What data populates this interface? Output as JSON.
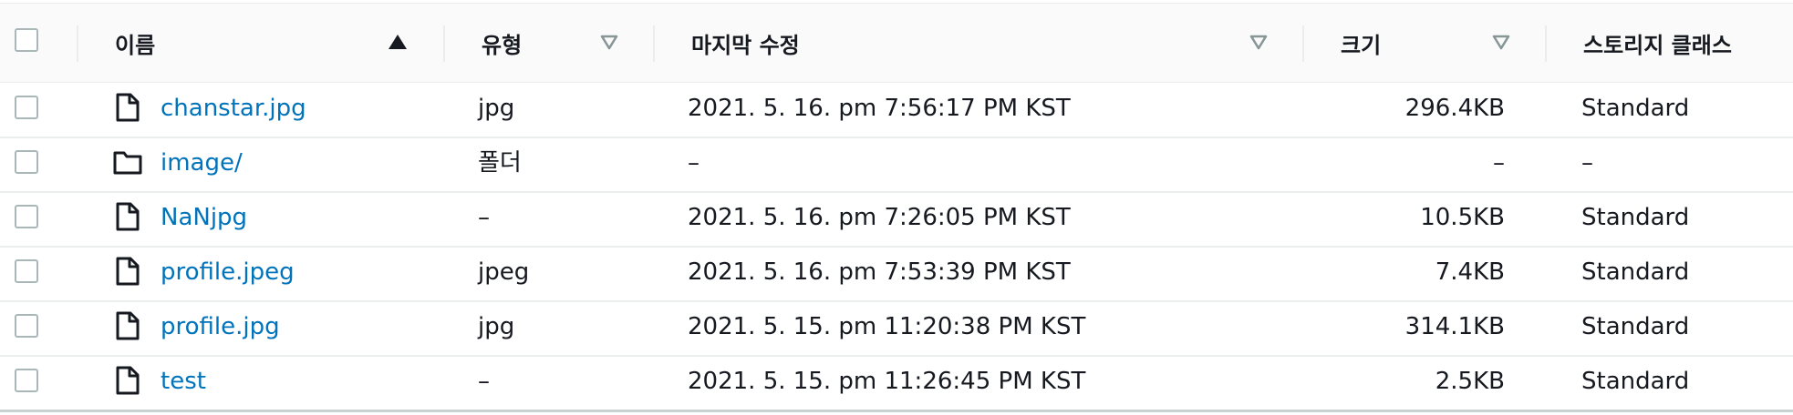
{
  "header": {
    "name_label": "이름",
    "type_label": "유형",
    "modified_label": "마지막 수정",
    "size_label": "크기",
    "storage_class_label": "스토리지 클래스"
  },
  "rows": [
    {
      "name": "chanstar.jpg",
      "kind": "file",
      "type": "jpg",
      "modified": "2021. 5. 16. pm 7:56:17 PM KST",
      "size": "296.4KB",
      "storage": "Standard"
    },
    {
      "name": "image/",
      "kind": "folder",
      "type": "폴더",
      "modified": "–",
      "size": "–",
      "storage": "–"
    },
    {
      "name": "NaNjpg",
      "kind": "file",
      "type": "–",
      "modified": "2021. 5. 16. pm 7:26:05 PM KST",
      "size": "10.5KB",
      "storage": "Standard"
    },
    {
      "name": "profile.jpeg",
      "kind": "file",
      "type": "jpeg",
      "modified": "2021. 5. 16. pm 7:53:39 PM KST",
      "size": "7.4KB",
      "storage": "Standard"
    },
    {
      "name": "profile.jpg",
      "kind": "file",
      "type": "jpg",
      "modified": "2021. 5. 15. pm 11:20:38 PM KST",
      "size": "314.1KB",
      "storage": "Standard"
    },
    {
      "name": "test",
      "kind": "file",
      "type": "–",
      "modified": "2021. 5. 15. pm 11:26:45 PM KST",
      "size": "2.5KB",
      "storage": "Standard"
    }
  ],
  "icons": {
    "file": "file-icon",
    "folder": "folder-icon",
    "sort_ascending": "sort-ascending-icon",
    "sort_unsorted": "sort-unsorted-icon"
  },
  "colors": {
    "link": "#0073bb",
    "text": "#16191f",
    "header_bg": "#fafafa",
    "border": "#eaeded",
    "checkbox_border": "#aab7b8",
    "sort_inactive": "#879596"
  }
}
